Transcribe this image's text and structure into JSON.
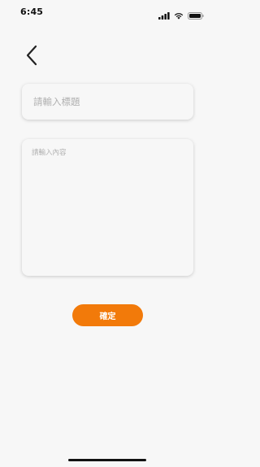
{
  "status_bar": {
    "time": "6:45"
  },
  "icons": {
    "signal": "cellular-signal-icon",
    "wifi": "wifi-icon",
    "battery": "battery-icon",
    "back": "chevron-left-icon"
  },
  "form": {
    "title_placeholder": "請輸入標題",
    "title_value": "",
    "content_placeholder": "請輸入內容",
    "content_value": "",
    "confirm_label": "確定"
  },
  "colors": {
    "accent": "#f27a0a",
    "background": "#f7f7f7"
  }
}
